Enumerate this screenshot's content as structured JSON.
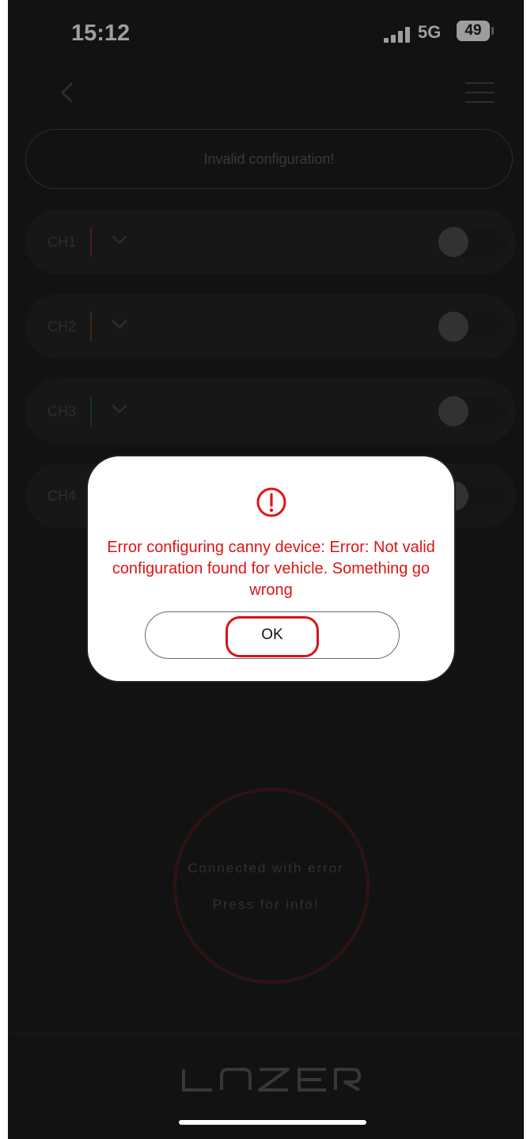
{
  "status_bar": {
    "time": "15:12",
    "network": "5G",
    "battery": "49"
  },
  "header": {
    "back_icon": "chevron-left-icon",
    "menu_icon": "hamburger-menu-icon"
  },
  "notice": {
    "text": "Invalid configuration!"
  },
  "channels": [
    {
      "label": "CH1",
      "color": "#7a2b46",
      "enabled": false
    },
    {
      "label": "CH2",
      "color": "#6b3a1e",
      "enabled": false
    },
    {
      "label": "CH3",
      "color": "#1f5a2a",
      "enabled": false
    },
    {
      "label": "CH4",
      "color": "#3a3a3a",
      "enabled": false
    }
  ],
  "status_circle": {
    "line1": "Connected with error",
    "line2": "Press for info!",
    "ring_color": "#4d1d1d"
  },
  "brand": {
    "logo": "LAZER"
  },
  "dialog": {
    "icon": "alert-circle-icon",
    "message": "Error configuring canny device: Error: Not valid configuration found for vehicle. Something go wrong",
    "ok_label": "OK",
    "accent": "#e01414"
  }
}
